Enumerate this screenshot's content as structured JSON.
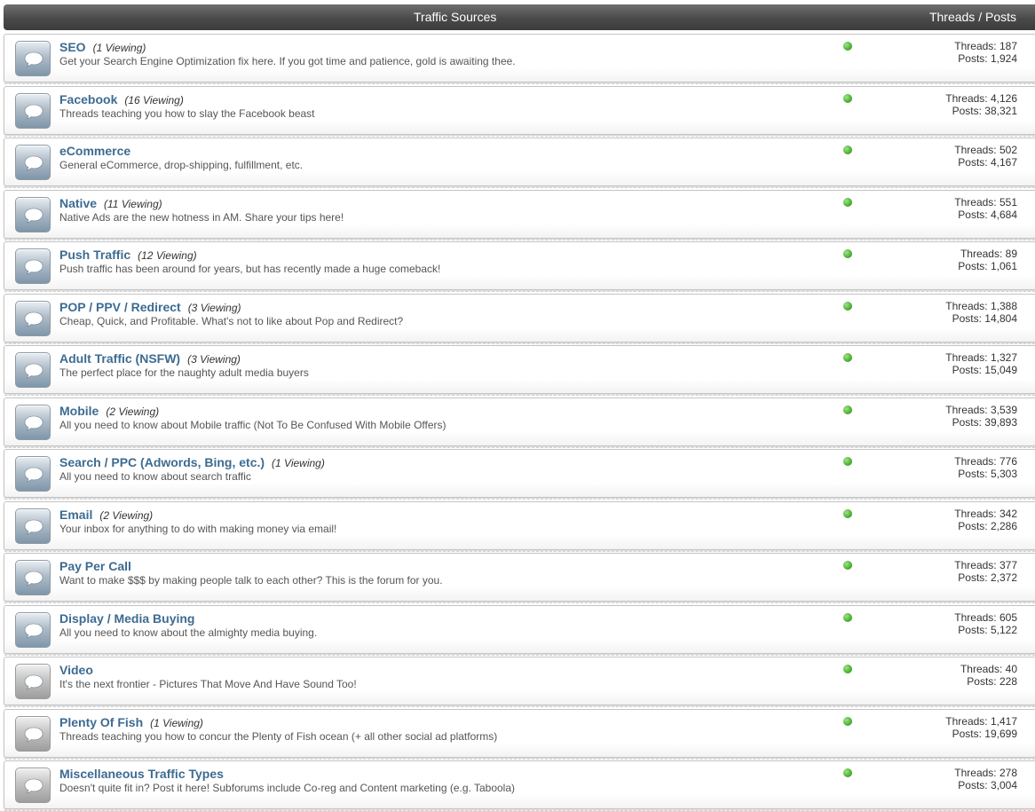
{
  "header": {
    "title": "Traffic Sources",
    "stats_label": "Threads / Posts"
  },
  "forums": [
    {
      "title": "SEO",
      "viewing": "(1 Viewing)",
      "description": "Get your Search Engine Optimization fix here. If you got time and patience, gold is awaiting thee.",
      "threads": "Threads: 187",
      "posts": "Posts: 1,924"
    },
    {
      "title": "Facebook",
      "viewing": "(16 Viewing)",
      "description": "Threads teaching you how to slay the Facebook beast",
      "threads": "Threads: 4,126",
      "posts": "Posts: 38,321"
    },
    {
      "title": "eCommerce",
      "viewing": "",
      "description": "General eCommerce, drop-shipping, fulfillment, etc.",
      "threads": "Threads: 502",
      "posts": "Posts: 4,167"
    },
    {
      "title": "Native",
      "viewing": "(11 Viewing)",
      "description": "Native Ads are the new hotness in AM. Share your tips here!",
      "threads": "Threads: 551",
      "posts": "Posts: 4,684"
    },
    {
      "title": "Push Traffic",
      "viewing": "(12 Viewing)",
      "description": "Push traffic has been around for years, but has recently made a huge comeback!",
      "threads": "Threads: 89",
      "posts": "Posts: 1,061"
    },
    {
      "title": "POP / PPV / Redirect",
      "viewing": "(3 Viewing)",
      "description": "Cheap, Quick, and Profitable. What's not to like about Pop and Redirect?",
      "threads": "Threads: 1,388",
      "posts": "Posts: 14,804"
    },
    {
      "title": "Adult Traffic (NSFW)",
      "viewing": "(3 Viewing)",
      "description": "The perfect place for the naughty adult media buyers",
      "threads": "Threads: 1,327",
      "posts": "Posts: 15,049"
    },
    {
      "title": "Mobile",
      "viewing": "(2 Viewing)",
      "description": "All you need to know about Mobile traffic (Not To Be Confused With Mobile Offers)",
      "threads": "Threads: 3,539",
      "posts": "Posts: 39,893"
    },
    {
      "title": "Search / PPC (Adwords, Bing, etc.)",
      "viewing": "(1 Viewing)",
      "description": "All you need to know about search traffic",
      "threads": "Threads: 776",
      "posts": "Posts: 5,303"
    },
    {
      "title": "Email",
      "viewing": "(2 Viewing)",
      "description": "Your inbox for anything to do with making money via email!",
      "threads": "Threads: 342",
      "posts": "Posts: 2,286"
    },
    {
      "title": "Pay Per Call",
      "viewing": "",
      "description": "Want to make $$$ by making people talk to each other? This is the forum for you.",
      "threads": "Threads: 377",
      "posts": "Posts: 2,372"
    },
    {
      "title": "Display / Media Buying",
      "viewing": "",
      "description": "All you need to know about the almighty media buying.",
      "threads": "Threads: 605",
      "posts": "Posts: 5,122"
    },
    {
      "title": "Video",
      "viewing": "",
      "description": "It's the next frontier - Pictures That Move And Have Sound Too!",
      "threads": "Threads: 40",
      "posts": "Posts: 228",
      "icon": "grey"
    },
    {
      "title": "Plenty Of Fish",
      "viewing": "(1 Viewing)",
      "description": "Threads teaching you how to concur the Plenty of Fish ocean (+ all other social ad platforms)",
      "threads": "Threads: 1,417",
      "posts": "Posts: 19,699",
      "icon": "grey"
    },
    {
      "title": "Miscellaneous Traffic Types",
      "viewing": "",
      "description": "Doesn't quite fit in? Post it here! Subforums include Co-reg and Content marketing (e.g. Taboola)",
      "threads": "Threads: 278",
      "posts": "Posts: 3,004",
      "icon": "grey"
    }
  ],
  "colors": {
    "title_link": "#3d6b91",
    "status_online": "#4bb02f",
    "header_bg": "#4a4a4a"
  },
  "icons": {
    "forum": "speech-bubble-icon",
    "status": "online-status-icon"
  }
}
